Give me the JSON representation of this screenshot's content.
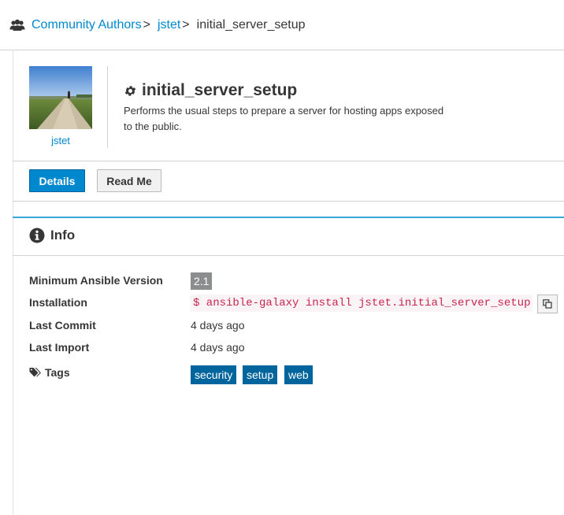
{
  "breadcrumb": {
    "icon": "users-icon",
    "items": [
      {
        "label": "Community Authors"
      },
      {
        "label": "jstet"
      }
    ],
    "separator": ">",
    "current": "initial_server_setup"
  },
  "author": {
    "name": "jstet",
    "avatar": "avatar-photo"
  },
  "role": {
    "title_icon": "gear-icon",
    "title": "initial_server_setup",
    "description": "Performs the usual steps to prepare a server for hosting apps exposed to the public."
  },
  "tabs": {
    "details": "Details",
    "readme": "Read Me"
  },
  "info": {
    "icon": "info-circle-icon",
    "title": "Info",
    "min_ansible_label": "Minimum Ansible Version",
    "min_ansible_value": "2.1",
    "installation_label": "Installation",
    "installation_command": "$ ansible-galaxy install jstet.initial_server_setup",
    "copy_icon": "copy-icon",
    "last_commit_label": "Last Commit",
    "last_commit_value": "4 days ago",
    "last_import_label": "Last Import",
    "last_import_value": "4 days ago",
    "tags_icon": "tags-icon",
    "tags_label": "Tags",
    "tags": [
      "security",
      "setup",
      "web"
    ]
  },
  "colors": {
    "link": "#0088ce",
    "primary_button": "#0088ce",
    "tag_background": "#00659c",
    "panel_accent": "#39a5dc",
    "code_text": "#c7254e",
    "version_badge": "#8b8d8f"
  }
}
